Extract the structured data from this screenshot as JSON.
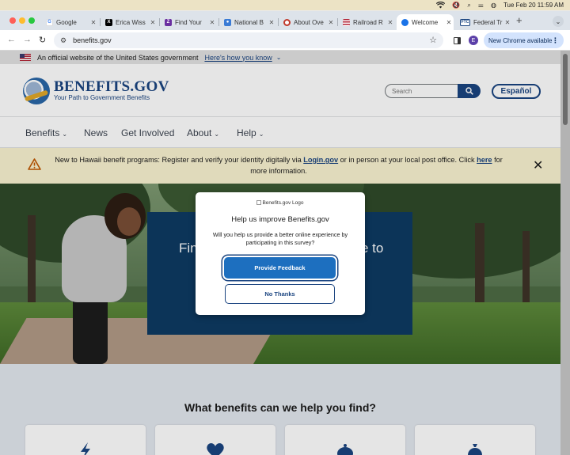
{
  "menubar": {
    "datetime": "Tue Feb 20  11:59 AM"
  },
  "tabs": [
    {
      "title": "Google",
      "favicon": "G",
      "color": "#ffffff",
      "fg": "#4285f4"
    },
    {
      "title": "Erica Wiss",
      "favicon": "X",
      "color": "#000000",
      "fg": "#ffffff"
    },
    {
      "title": "Find Your",
      "favicon": "Z",
      "color": "#6a2ea0",
      "fg": "#ffffff"
    },
    {
      "title": "National B",
      "favicon": "user",
      "color": "#3a7bd5",
      "fg": "#ffffff"
    },
    {
      "title": "About Ove",
      "favicon": "ring",
      "color": "#c0392b",
      "fg": "#ffffff"
    },
    {
      "title": "Railroad R",
      "favicon": "flag",
      "color": "#b22234",
      "fg": "#ffffff"
    },
    {
      "title": "Welcome",
      "favicon": "globe",
      "color": "#1a73e8",
      "fg": "#ffffff"
    },
    {
      "title": "Federal Tr",
      "favicon": "FTC",
      "color": "#ffffff",
      "fg": "#1a4480"
    }
  ],
  "omnibox": {
    "url": "benefits.gov"
  },
  "toolbar": {
    "new_chrome": "New Chrome available",
    "avatar_letter": "E"
  },
  "gov_banner": {
    "text": "An official website of the United States government",
    "link": "Here's how you know"
  },
  "header": {
    "logo_title": "BENEFITS.GOV",
    "logo_tagline": "Your Path to Government Benefits",
    "search_placeholder": "Search",
    "espanol": "Español"
  },
  "nav": {
    "items": [
      "Benefits",
      "News",
      "Get Involved",
      "About",
      "Help"
    ]
  },
  "alert": {
    "text_before": "New to Hawaii benefit programs: Register and verify your identity digitally via ",
    "link1": "Login.gov",
    "text_middle": " or in person at your local post office. Click ",
    "link2": "here",
    "text_after": " for more information."
  },
  "hero": {
    "heading_left": "Fin",
    "heading_right": "e to"
  },
  "modal": {
    "logo_alt": "Benefits.gov Logo",
    "title": "Help us improve Benefits.gov",
    "description": "Will you help us provide a better online experience by participating in this survey?",
    "primary": "Provide Feedback",
    "secondary": "No Thanks"
  },
  "benefits_section": {
    "heading": "What benefits can we help you find?"
  },
  "colors": {
    "brand_blue": "#1a4480",
    "alert_bg": "#faf3d1",
    "primary_button": "#1d6fbf"
  }
}
